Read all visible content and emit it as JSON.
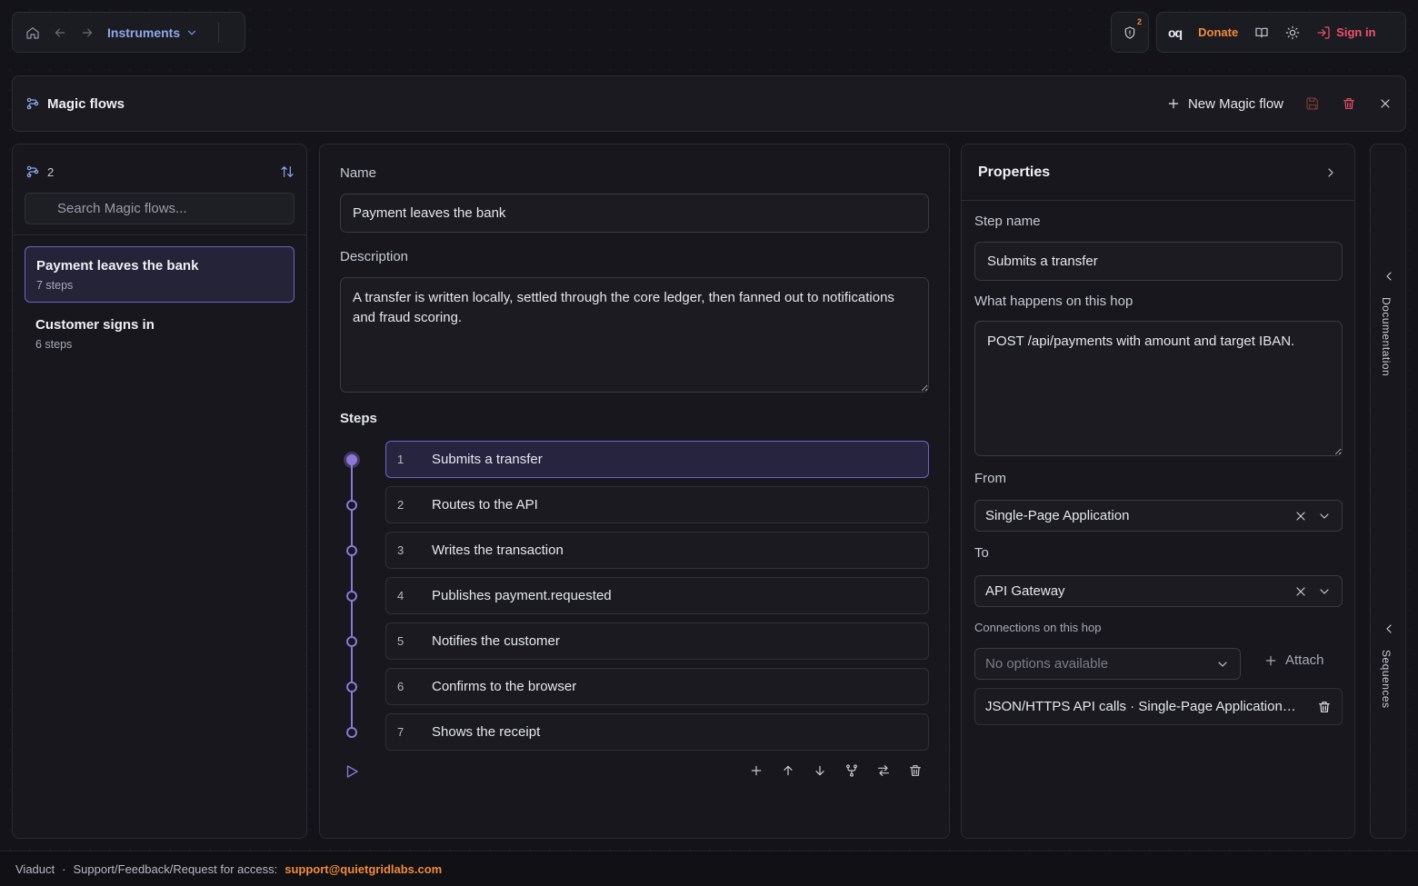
{
  "topbar": {
    "breadcrumb": "Instruments",
    "notification_count": "2",
    "logo_text": "oq",
    "donate": "Donate",
    "sign_in": "Sign in"
  },
  "magic_flows": {
    "title": "Magic flows",
    "new_button": "New Magic flow"
  },
  "sidebar": {
    "count": "2",
    "search_placeholder": "Search Magic flows...",
    "flows": [
      {
        "name": "Payment leaves the bank",
        "steps": "7 steps",
        "active": true
      },
      {
        "name": "Customer signs in",
        "steps": "6 steps",
        "active": false
      }
    ]
  },
  "editor": {
    "name_label": "Name",
    "name_value": "Payment leaves the bank",
    "description_label": "Description",
    "description_value": "A transfer is written locally, settled through the core ledger, then fanned out to notifications and fraud scoring.",
    "steps_label": "Steps",
    "steps": [
      {
        "num": "1",
        "label": "Submits a transfer"
      },
      {
        "num": "2",
        "label": "Routes to the API"
      },
      {
        "num": "3",
        "label": "Writes the transaction"
      },
      {
        "num": "4",
        "label": "Publishes payment.requested"
      },
      {
        "num": "5",
        "label": "Notifies the customer"
      },
      {
        "num": "6",
        "label": "Confirms to the browser"
      },
      {
        "num": "7",
        "label": "Shows the receipt"
      }
    ]
  },
  "properties": {
    "title": "Properties",
    "step_name_label": "Step name",
    "step_name_value": "Submits a transfer",
    "hop_label": "What happens on this hop",
    "hop_value": "POST /api/payments with amount and target IBAN.",
    "from_label": "From",
    "from_value": "Single-Page Application",
    "to_label": "To",
    "to_value": "API Gateway",
    "connections_label": "Connections on this hop",
    "connections_placeholder": "No options available",
    "attach_label": "Attach",
    "connection_item": "JSON/HTTPS API calls · Single-Page Application…"
  },
  "rail": {
    "documentation": "Documentation",
    "sequences": "Sequences"
  },
  "footer": {
    "app": "Viaduct",
    "dot": "·",
    "support_text": "Support/Feedback/Request for access:",
    "email": "support@quietgridlabs.com"
  },
  "colors": {
    "accent": "#8b78d8",
    "orange": "#f28a3c",
    "danger": "#f0506a"
  }
}
